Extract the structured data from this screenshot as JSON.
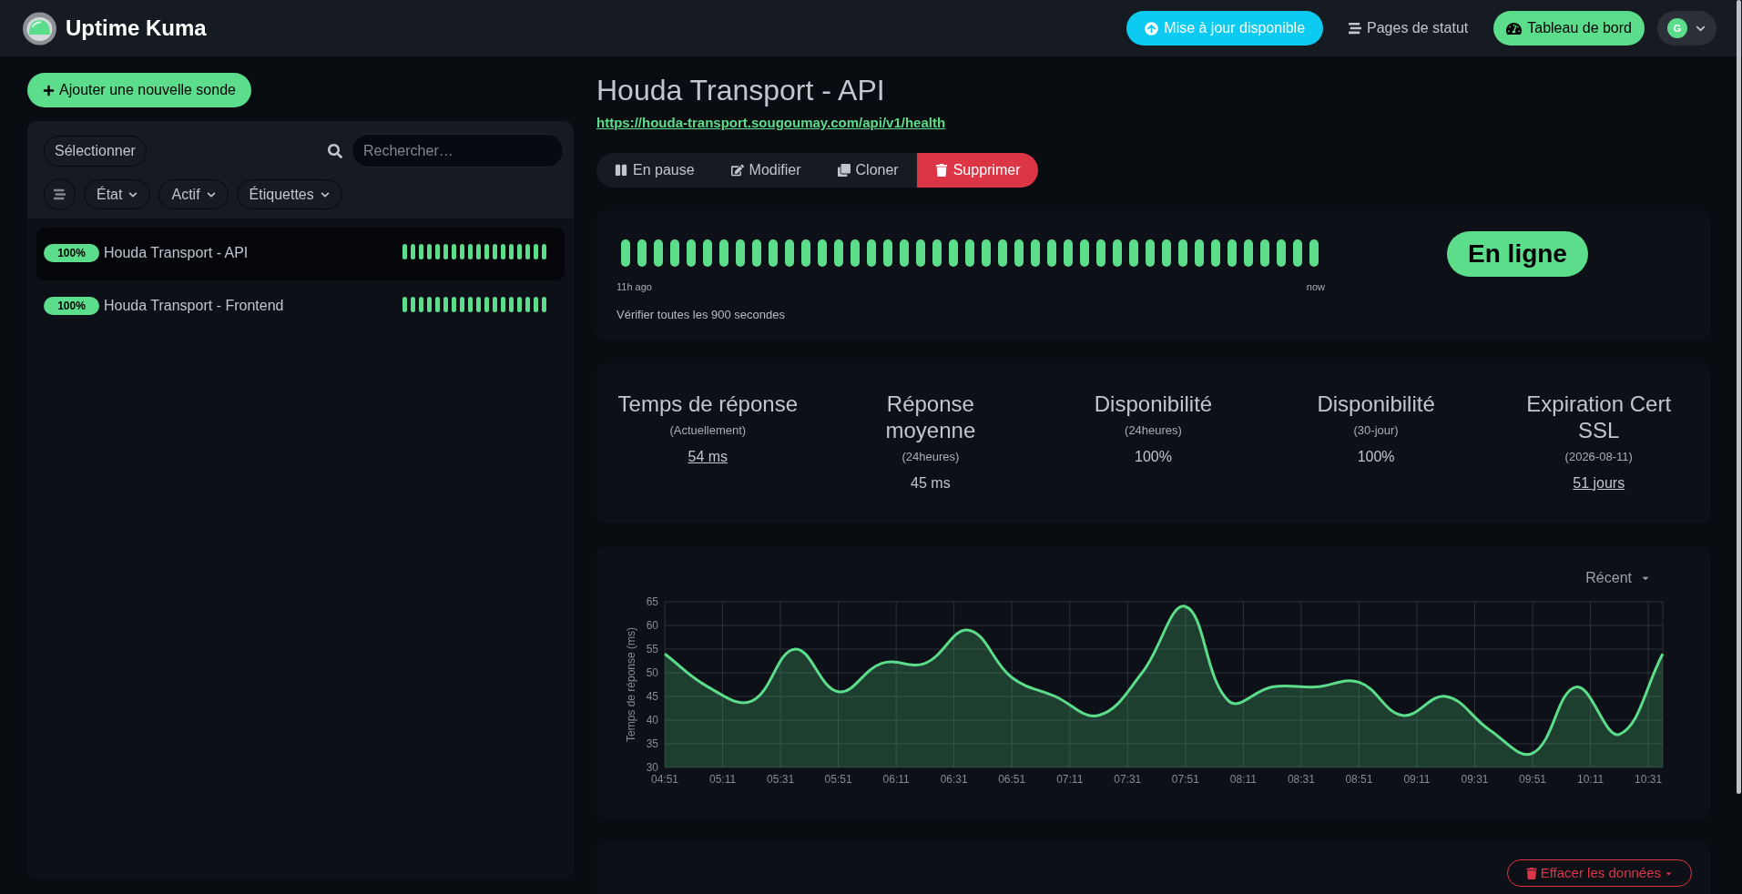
{
  "header": {
    "app_name": "Uptime Kuma",
    "buttons": [
      {
        "label": "Mise à jour disponible",
        "kind": "update"
      },
      {
        "label": "Pages de statut",
        "kind": "link"
      },
      {
        "label": "Tableau de bord",
        "kind": "primary"
      }
    ],
    "profile": {
      "initial": "G"
    }
  },
  "sidebar": {
    "add_button": "Ajouter une nouvelle sonde",
    "select_button": "Sélectionner",
    "search": {
      "placeholder": "Rechercher…"
    },
    "filters": [
      "État",
      "Actif",
      "Étiquettes"
    ],
    "monitors": [
      {
        "uptime": "100%",
        "name": "Houda Transport - API",
        "selected": true,
        "beats": [
          {
            "up": true
          },
          {
            "up": true
          },
          {
            "up": true
          },
          {
            "up": true
          },
          {
            "up": true
          },
          {
            "up": true
          },
          {
            "up": true
          },
          {
            "up": true
          },
          {
            "up": true
          },
          {
            "up": true
          },
          {
            "up": true
          },
          {
            "up": true
          },
          {
            "up": true
          },
          {
            "up": true
          },
          {
            "up": true
          },
          {
            "up": true
          },
          {
            "up": true
          },
          {
            "up": true
          }
        ]
      },
      {
        "uptime": "100%",
        "name": "Houda Transport - Frontend",
        "selected": false,
        "beats": [
          {
            "up": true
          },
          {
            "up": true
          },
          {
            "up": true
          },
          {
            "up": true
          },
          {
            "up": true
          },
          {
            "up": true
          },
          {
            "up": true
          },
          {
            "up": true
          },
          {
            "up": true
          },
          {
            "up": true
          },
          {
            "up": true
          },
          {
            "up": true
          },
          {
            "up": true
          },
          {
            "up": true
          },
          {
            "up": true
          },
          {
            "up": true
          },
          {
            "up": true
          },
          {
            "up": true
          }
        ]
      }
    ]
  },
  "monitor": {
    "title": "Houda Transport - API",
    "url": "https://houda-transport.sougoumay.com/api/v1/health",
    "actions": [
      {
        "label": "En pause",
        "kind": "pause"
      },
      {
        "label": "Modifier",
        "kind": "edit"
      },
      {
        "label": "Cloner",
        "kind": "clone"
      },
      {
        "label": "Supprimer",
        "kind": "delete"
      }
    ],
    "heartbeat": {
      "beats": [
        {
          "up": true
        },
        {
          "up": true
        },
        {
          "up": true
        },
        {
          "up": true
        },
        {
          "up": true
        },
        {
          "up": true
        },
        {
          "up": true
        },
        {
          "up": true
        },
        {
          "up": true
        },
        {
          "up": true
        },
        {
          "up": true
        },
        {
          "up": true
        },
        {
          "up": true
        },
        {
          "up": true
        },
        {
          "up": true
        },
        {
          "up": true
        },
        {
          "up": true
        },
        {
          "up": true
        },
        {
          "up": true
        },
        {
          "up": true
        },
        {
          "up": true
        },
        {
          "up": true
        },
        {
          "up": true
        },
        {
          "up": true
        },
        {
          "up": true
        },
        {
          "up": true
        },
        {
          "up": true
        },
        {
          "up": true
        },
        {
          "up": true
        },
        {
          "up": true
        },
        {
          "up": true
        },
        {
          "up": true
        },
        {
          "up": true
        },
        {
          "up": true
        },
        {
          "up": true
        },
        {
          "up": true
        },
        {
          "up": true
        },
        {
          "up": true
        },
        {
          "up": true
        },
        {
          "up": true
        },
        {
          "up": true
        },
        {
          "up": true
        },
        {
          "up": true
        }
      ],
      "start_label": "11h ago",
      "end_label": "now",
      "interval_text": "Vérifier toutes les 900 secondes",
      "status": {
        "label": "En ligne",
        "kind": "up"
      }
    },
    "stats": [
      {
        "title": "Temps de réponse",
        "subtitle": "(Actuellement)",
        "value": "54 ms",
        "link": true
      },
      {
        "title": "Réponse moyenne",
        "subtitle": "(24heures)",
        "value": "45 ms",
        "link": false
      },
      {
        "title": "Disponibilité",
        "subtitle": "(24heures)",
        "value": "100%",
        "link": false
      },
      {
        "title": "Disponibilité",
        "subtitle": "(30-jour)",
        "value": "100%",
        "link": false
      },
      {
        "title": "Expiration Cert SSL",
        "subtitle": "(2026-08-11)",
        "value": "51 jours",
        "link": true
      }
    ],
    "chart": {
      "range_select": "Récent",
      "chart_data": {
        "type": "area",
        "ylabel": "Temps de réponse (ms)",
        "grid": true,
        "categories": [
          "04:51",
          null,
          null,
          null,
          "05:11",
          null,
          null,
          null,
          "05:31",
          null,
          null,
          null,
          "05:51",
          null,
          null,
          null,
          "06:11",
          null,
          null,
          null,
          "06:31",
          null,
          null,
          null,
          "06:51",
          null,
          null,
          null,
          "07:11",
          null,
          null,
          null,
          "07:31",
          null,
          null,
          null,
          "07:51",
          null,
          null,
          null,
          "08:11",
          null,
          null,
          null,
          "08:31",
          null,
          null,
          null,
          "08:51",
          null,
          null,
          null,
          "09:11",
          null,
          null,
          null,
          "09:31",
          null,
          null,
          null,
          "09:51",
          null,
          null,
          null,
          "10:11",
          null,
          null,
          null,
          "10:31",
          null
        ],
        "series": [
          {
            "color": "#5cdd8b",
            "values": [
              54,
              null,
              null,
              47,
              null,
              null,
              44,
              null,
              null,
              55,
              null,
              null,
              46,
              null,
              null,
              52,
              null,
              null,
              52,
              null,
              null,
              59,
              null,
              null,
              49,
              null,
              null,
              45,
              null,
              null,
              41,
              null,
              null,
              50,
              null,
              null,
              64,
              null,
              null,
              44,
              null,
              null,
              47,
              null,
              null,
              47,
              null,
              null,
              48,
              null,
              null,
              41,
              null,
              null,
              45,
              null,
              null,
              38,
              null,
              null,
              33,
              null,
              null,
              47,
              null,
              null,
              37,
              null,
              null,
              54
            ]
          }
        ],
        "ylim": [
          30,
          65
        ],
        "yticks": [
          30,
          35,
          40,
          45,
          50,
          55,
          60,
          65
        ]
      }
    },
    "clear_button": "Effacer les données"
  }
}
